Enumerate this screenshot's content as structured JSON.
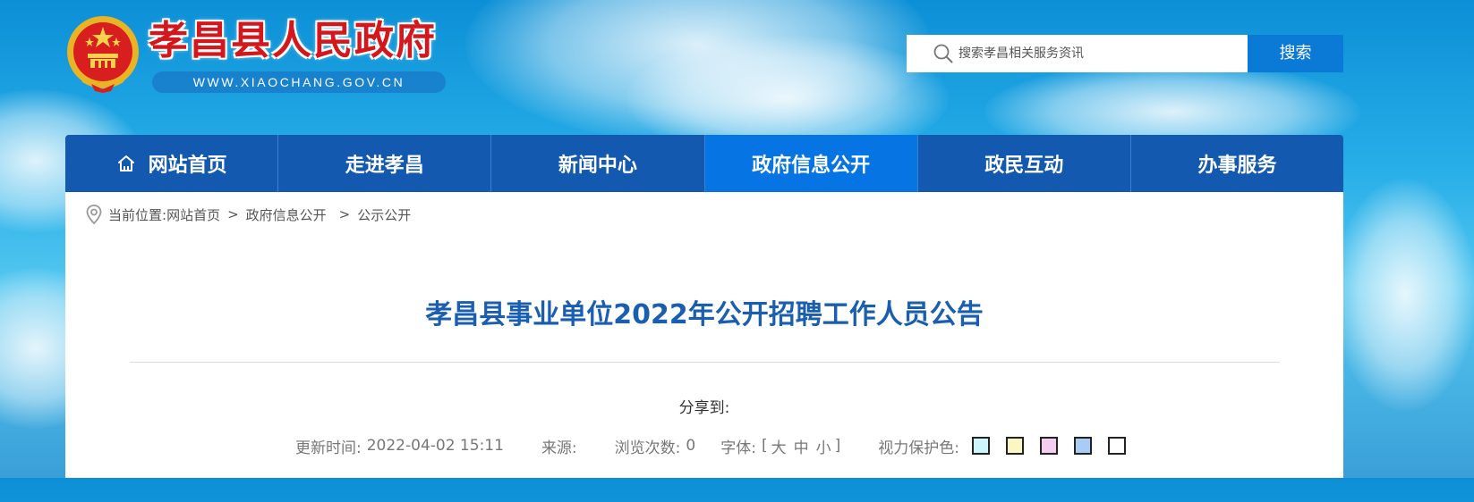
{
  "header": {
    "site_title": "孝昌县人民政府",
    "site_domain": "WWW.XIAOCHANG.GOV.CN",
    "search": {
      "placeholder": "搜索孝昌相关服务资讯",
      "button_label": "搜索"
    }
  },
  "nav": {
    "items": [
      {
        "label": "网站首页",
        "icon": "home-icon"
      },
      {
        "label": "走进孝昌"
      },
      {
        "label": "新闻中心"
      },
      {
        "label": "政府信息公开",
        "active": true
      },
      {
        "label": "政民互动"
      },
      {
        "label": "办事服务"
      }
    ]
  },
  "breadcrumb": {
    "prefix": "当前位置:",
    "items": [
      "网站首页",
      "政府信息公开",
      "公示公开"
    ],
    "separator": ">"
  },
  "article": {
    "title": "孝昌县事业单位2022年公开招聘工作人员公告",
    "share_label": "分享到:",
    "meta": {
      "updated_label": "更新时间:",
      "updated_value": "2022-04-02 15:11",
      "source_label": "来源:",
      "source_value": "",
      "views_label": "浏览次数:",
      "views_value": "0",
      "font_label": "字体:",
      "font_open": "[",
      "font_large": "大",
      "font_medium": "中",
      "font_small": "小",
      "font_close": "]",
      "eye_protect_label": "视力保护色:"
    },
    "eye_colors": [
      "#cdf5fb",
      "#f9f7c4",
      "#f4cdf1",
      "#a8cdf5",
      "#ffffff"
    ]
  },
  "colors": {
    "nav_bg": "#1359b0",
    "nav_active": "#0674e2",
    "title_red": "#d4161d",
    "article_title": "#1a5eb0",
    "search_button": "#0b7ad6"
  }
}
